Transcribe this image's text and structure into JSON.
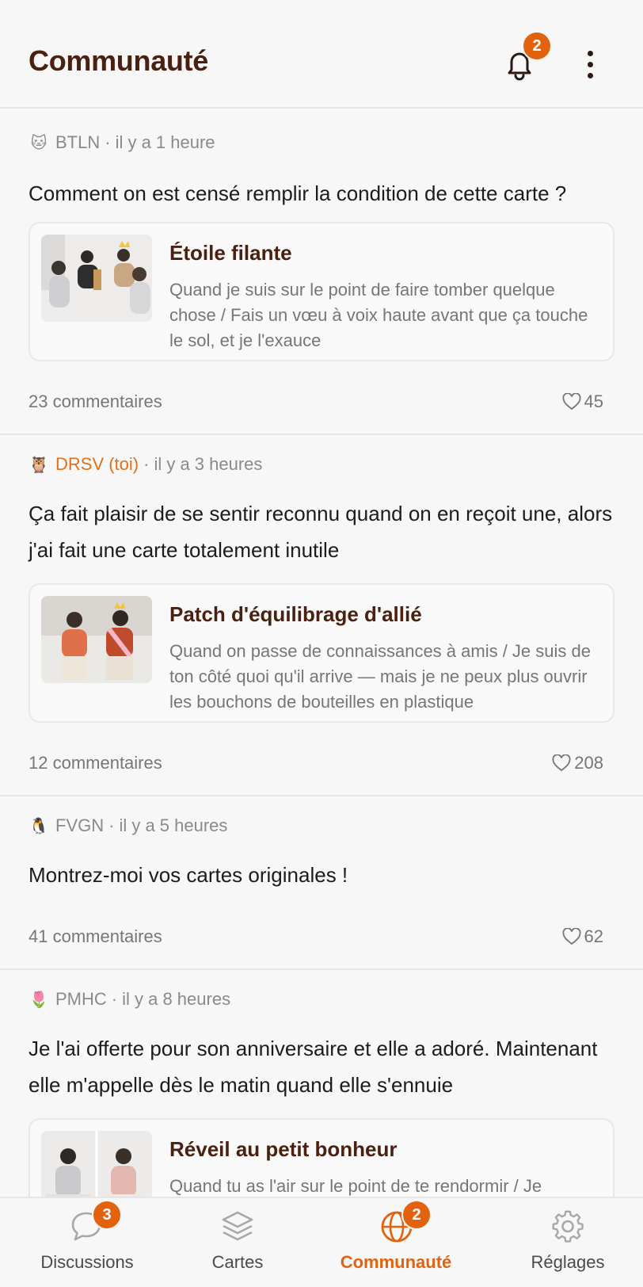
{
  "header": {
    "title": "Communauté",
    "notification_count": "2"
  },
  "posts": [
    {
      "avatar": "🐱",
      "author": "BTLN",
      "time": "il y a 1 heure",
      "text": "Comment on est censé remplir la condition de cette carte ?",
      "card": {
        "title": "Étoile filante",
        "description": "Quand je suis sur le point de faire tomber quelque chose / Fais un vœu à voix haute avant que ça touche le sol, et je l'exauce"
      },
      "comments": "23 commentaires",
      "likes": "45"
    },
    {
      "avatar": "🦉",
      "author": "DRSV (toi)",
      "time": "il y a 3 heures",
      "text": "Ça fait plaisir de se sentir reconnu quand on en reçoit une, alors j'ai fait une carte totalement inutile",
      "card": {
        "title": "Patch d'équilibrage d'allié",
        "description": "Quand on passe de connaissances à amis / Je suis de ton côté quoi qu'il arrive — mais je ne peux plus ouvrir les bouchons de bouteilles en plastique"
      },
      "comments": "12 commentaires",
      "likes": "208"
    },
    {
      "avatar": "🐧",
      "author": "FVGN",
      "time": "il y a 5 heures",
      "text": "Montrez-moi vos cartes originales !",
      "comments": "41 commentaires",
      "likes": "62"
    },
    {
      "avatar": "🌷",
      "author": "PMHC",
      "time": "il y a 8 heures",
      "text": "Je l'ai offerte pour son anniversaire et elle a adoré. Maintenant elle m'appelle dès le matin quand elle s'ennuie",
      "card": {
        "title": "Réveil au petit bonheur",
        "description": "Quand tu as l'air sur le point de te rendormir / Je"
      }
    }
  ],
  "nav": [
    {
      "label": "Discussions",
      "icon": "chat-bubble-icon",
      "badge": "3"
    },
    {
      "label": "Cartes",
      "icon": "cards-stack-icon"
    },
    {
      "label": "Communauté",
      "icon": "globe-icon",
      "badge": "2",
      "active": true
    },
    {
      "label": "Réglages",
      "icon": "gear-icon"
    }
  ],
  "colors": {
    "accent": "#e2620e",
    "title": "#4a2110",
    "self_author": "#e0701c"
  }
}
